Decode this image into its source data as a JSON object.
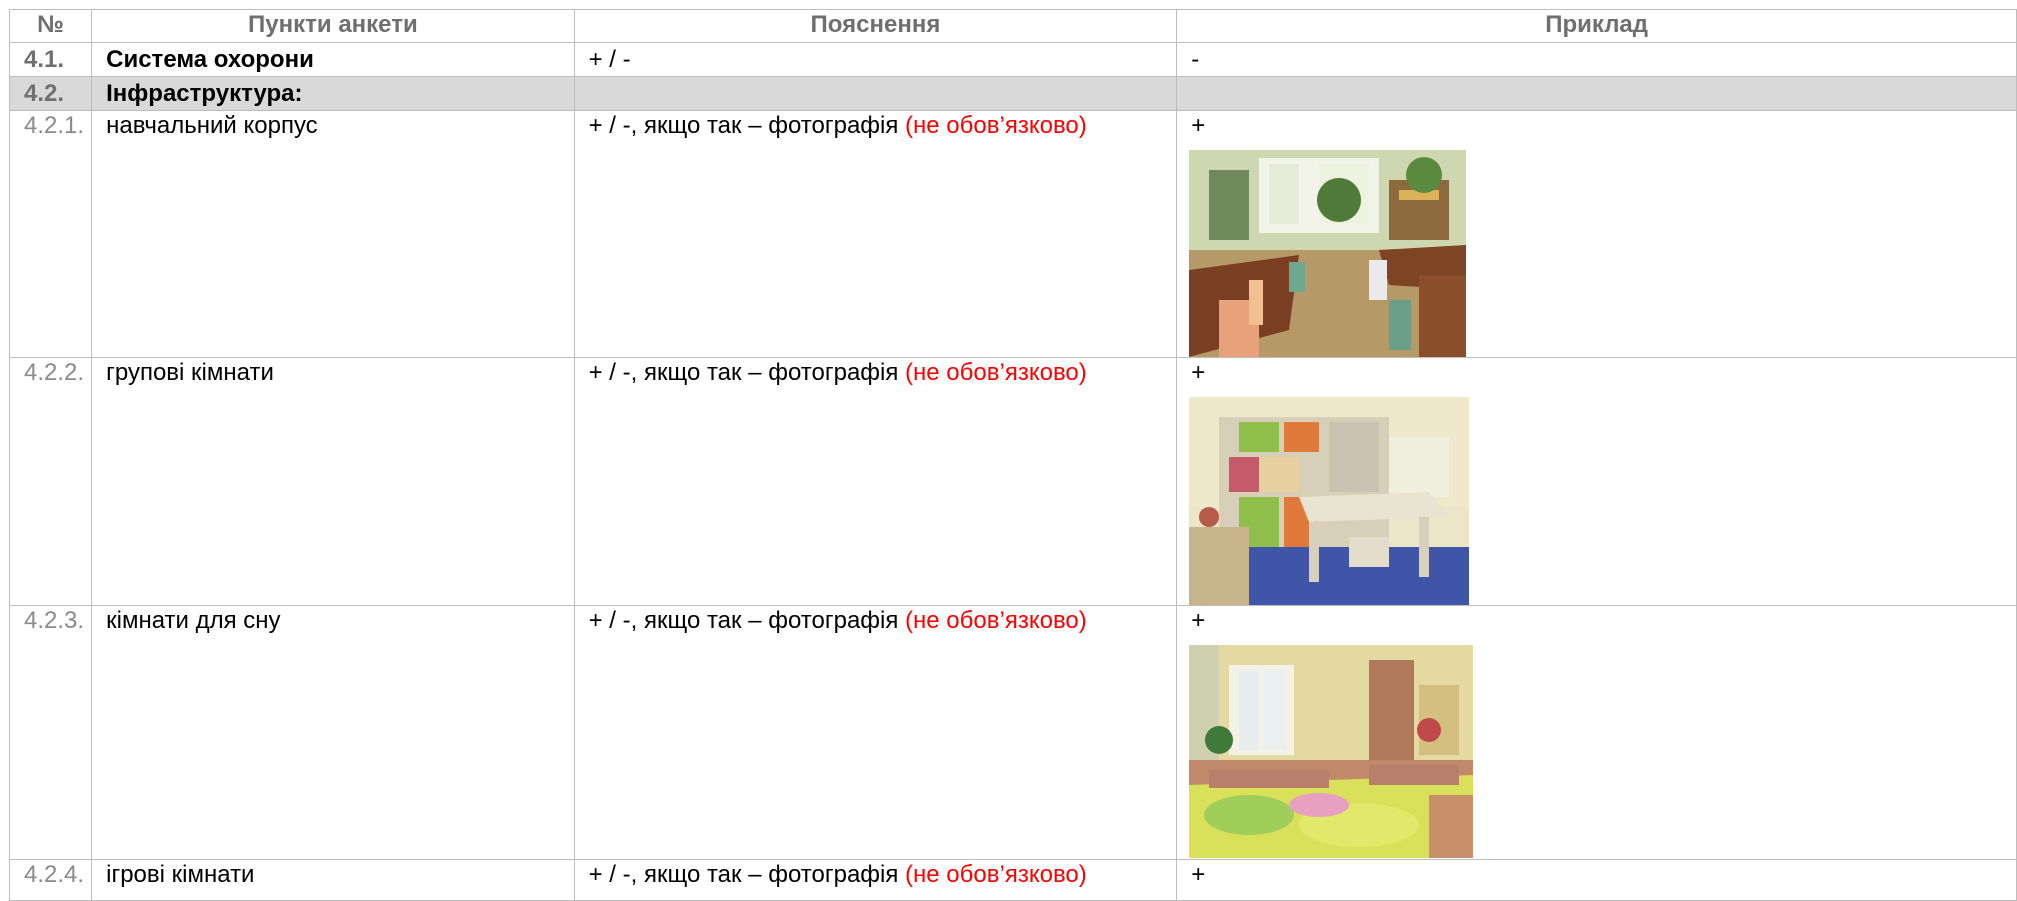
{
  "header": {
    "num": "№",
    "item": "Пункти анкети",
    "explanation": "Пояснення",
    "example": "Приклад"
  },
  "rows": [
    {
      "num": "4.1.",
      "item": "Система охорони",
      "explanation": "+ / -",
      "example": "-"
    },
    {
      "num": "4.2.",
      "item": "Інфраструктура:",
      "explanation": "",
      "example": ""
    },
    {
      "num": "4.2.1.",
      "item": "навчальний корпус",
      "explanation": "+ / -, якщо так – фотографія",
      "note": "(не обов’язково)",
      "example": "+",
      "photo_icon": "classroom-photo"
    },
    {
      "num": "4.2.2.",
      "item": "групові кімнати",
      "explanation": "+ / -, якщо так – фотографія",
      "note": "(не обов’язково)",
      "example": "+",
      "photo_icon": "group-room-photo"
    },
    {
      "num": "4.2.3.",
      "item": "кімнати для сну",
      "explanation": "+ / -, якщо так – фотографія",
      "note": "(не обов’язково)",
      "example": "+",
      "photo_icon": "bedroom-photo"
    },
    {
      "num": "4.2.4.",
      "item": "ігрові кімнати",
      "explanation": "+ / -, якщо так – фотографія",
      "note": "(не обов’язково)",
      "example": "+"
    }
  ],
  "colors": {
    "note": "#ff0000",
    "section_fill": "#d9d9d9",
    "border": "#bdbdbd",
    "header_text": "#6f6f6f"
  }
}
